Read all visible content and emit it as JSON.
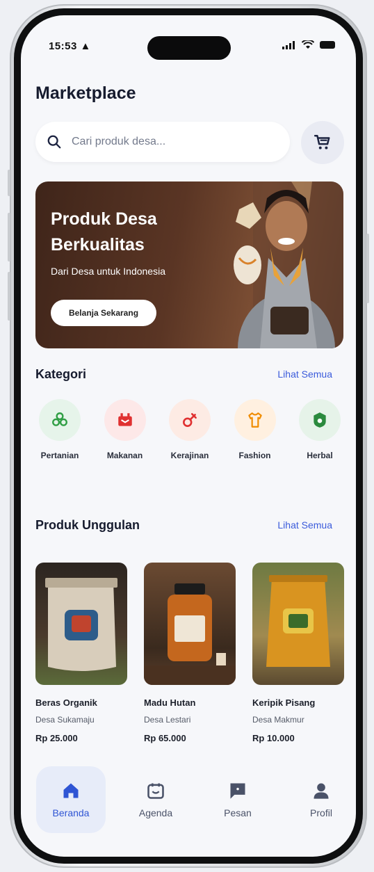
{
  "status": {
    "time": "15:53"
  },
  "header": {
    "title": "Marketplace"
  },
  "search": {
    "placeholder": "Cari produk desa..."
  },
  "banner": {
    "title": "Produk Desa Berkualitas",
    "subtitle": "Dari Desa untuk Indonesia",
    "cta": "Belanja Sekarang"
  },
  "categories": {
    "title": "Kategori",
    "see_all": "Lihat Semua",
    "items": [
      {
        "label": "Pertanian",
        "icon": "plant-icon",
        "color": "#2f9e44",
        "bg": "#e6f4ea"
      },
      {
        "label": "Makanan",
        "icon": "food-icon",
        "color": "#e03131",
        "bg": "#fde8e8"
      },
      {
        "label": "Kerajinan",
        "icon": "craft-icon",
        "color": "#e8590c",
        "bg": "#fdebe4"
      },
      {
        "label": "Fashion",
        "icon": "shirt-icon",
        "color": "#f08c00",
        "bg": "#fff0e0"
      },
      {
        "label": "Herbal",
        "icon": "herbal-icon",
        "color": "#2b8a3e",
        "bg": "#e6f3e9"
      }
    ]
  },
  "featured": {
    "title": "Produk Unggulan",
    "see_all": "Lihat Semua",
    "items": [
      {
        "name": "Beras Organik",
        "village": "Desa Sukamaju",
        "price": "Rp 25.000"
      },
      {
        "name": "Madu Hutan",
        "village": "Desa Lestari",
        "price": "Rp 65.000"
      },
      {
        "name": "Keripik Pisang",
        "village": "Desa Makmur",
        "price": "Rp 10.000"
      }
    ]
  },
  "tabbar": {
    "items": [
      {
        "label": "Beranda",
        "icon": "home-icon",
        "active": true
      },
      {
        "label": "Agenda",
        "icon": "calendar-icon",
        "active": false
      },
      {
        "label": "Pesan",
        "icon": "message-icon",
        "active": false
      },
      {
        "label": "Profil",
        "icon": "user-icon",
        "active": false
      }
    ]
  },
  "colors": {
    "accent": "#2f55d4",
    "title": "#161b2e"
  }
}
